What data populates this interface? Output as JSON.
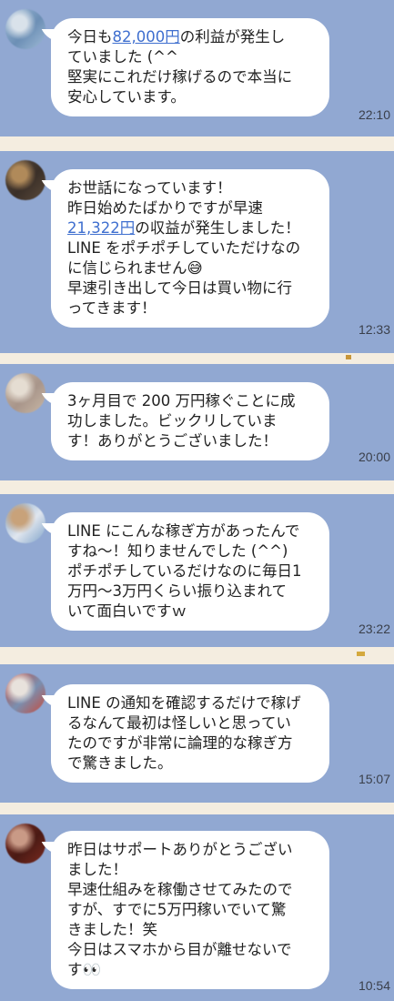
{
  "messages": [
    {
      "avatar_colors": [
        "#9fbad6",
        "#d9e2ea",
        "#6c8fb5"
      ],
      "lines": [
        {
          "before": "今日も",
          "link": "82,000円",
          "after": "の利益が発生し"
        },
        {
          "before": "ていました (^^",
          "link": "",
          "after": ""
        },
        {
          "before": "堅実にこれだけ稼げるので本当に",
          "link": "",
          "after": ""
        },
        {
          "before": "安心しています。",
          "link": "",
          "after": ""
        }
      ],
      "time": "22:10"
    },
    {
      "avatar_colors": [
        "#5a4a3a",
        "#b08a5a",
        "#3a2f28"
      ],
      "lines": [
        {
          "before": "お世話になっています！",
          "link": "",
          "after": ""
        },
        {
          "before": "昨日始めたばかりですが早速",
          "link": "",
          "after": ""
        },
        {
          "before": "",
          "link": "21,322円",
          "after": "の収益が発生しました！"
        },
        {
          "before": "LINE をポチポチしていただけなの",
          "link": "",
          "after": ""
        },
        {
          "before": "に信じられません😅",
          "link": "",
          "after": ""
        },
        {
          "before": "早速引き出して今日は買い物に行",
          "link": "",
          "after": ""
        },
        {
          "before": "ってきます！",
          "link": "",
          "after": ""
        }
      ],
      "time": "12:33"
    },
    {
      "avatar_colors": [
        "#c9b8a6",
        "#e5ddd2",
        "#a8958a"
      ],
      "lines": [
        {
          "before": "3ヶ月目で 200 万円稼ぐことに成",
          "link": "",
          "after": ""
        },
        {
          "before": "功しました。ビックリしていま",
          "link": "",
          "after": ""
        },
        {
          "before": "す！ありがとうございました！",
          "link": "",
          "after": ""
        }
      ],
      "time": "20:00"
    },
    {
      "avatar_colors": [
        "#7fa3c9",
        "#c8a27a",
        "#e0e6ee"
      ],
      "lines": [
        {
          "before": "LINE にこんな稼ぎ方があったんで",
          "link": "",
          "after": ""
        },
        {
          "before": "すね〜！知りませんでした (^^)",
          "link": "",
          "after": ""
        },
        {
          "before": "ポチポチしているだけなのに毎日1",
          "link": "",
          "after": ""
        },
        {
          "before": "万円〜3万円くらい振り込まれて",
          "link": "",
          "after": ""
        },
        {
          "before": "いて面白いですｗ",
          "link": "",
          "after": ""
        }
      ],
      "time": "23:22"
    },
    {
      "avatar_colors": [
        "#c74a3a",
        "#e8e2dc",
        "#7a8fb0"
      ],
      "lines": [
        {
          "before": "LINE の通知を確認するだけで稼げ",
          "link": "",
          "after": ""
        },
        {
          "before": "るなんて最初は怪しいと思ってい",
          "link": "",
          "after": ""
        },
        {
          "before": "たのですが非常に論理的な稼ぎ方",
          "link": "",
          "after": ""
        },
        {
          "before": "で驚きました。",
          "link": "",
          "after": ""
        }
      ],
      "time": "15:07"
    },
    {
      "avatar_colors": [
        "#7a2a20",
        "#c99a86",
        "#4a1a14"
      ],
      "lines": [
        {
          "before": "昨日はサポートありがとうござい",
          "link": "",
          "after": ""
        },
        {
          "before": "ました！",
          "link": "",
          "after": ""
        },
        {
          "before": "早速仕組みを稼働させてみたので",
          "link": "",
          "after": ""
        },
        {
          "before": "すが、すでに5万円稼いでいて驚",
          "link": "",
          "after": ""
        },
        {
          "before": "きました！笑",
          "link": "",
          "after": ""
        },
        {
          "before": "今日はスマホから目が離せないで",
          "link": "",
          "after": ""
        },
        {
          "before": "す👀",
          "link": "",
          "after": ""
        }
      ],
      "time": "10:54"
    }
  ]
}
